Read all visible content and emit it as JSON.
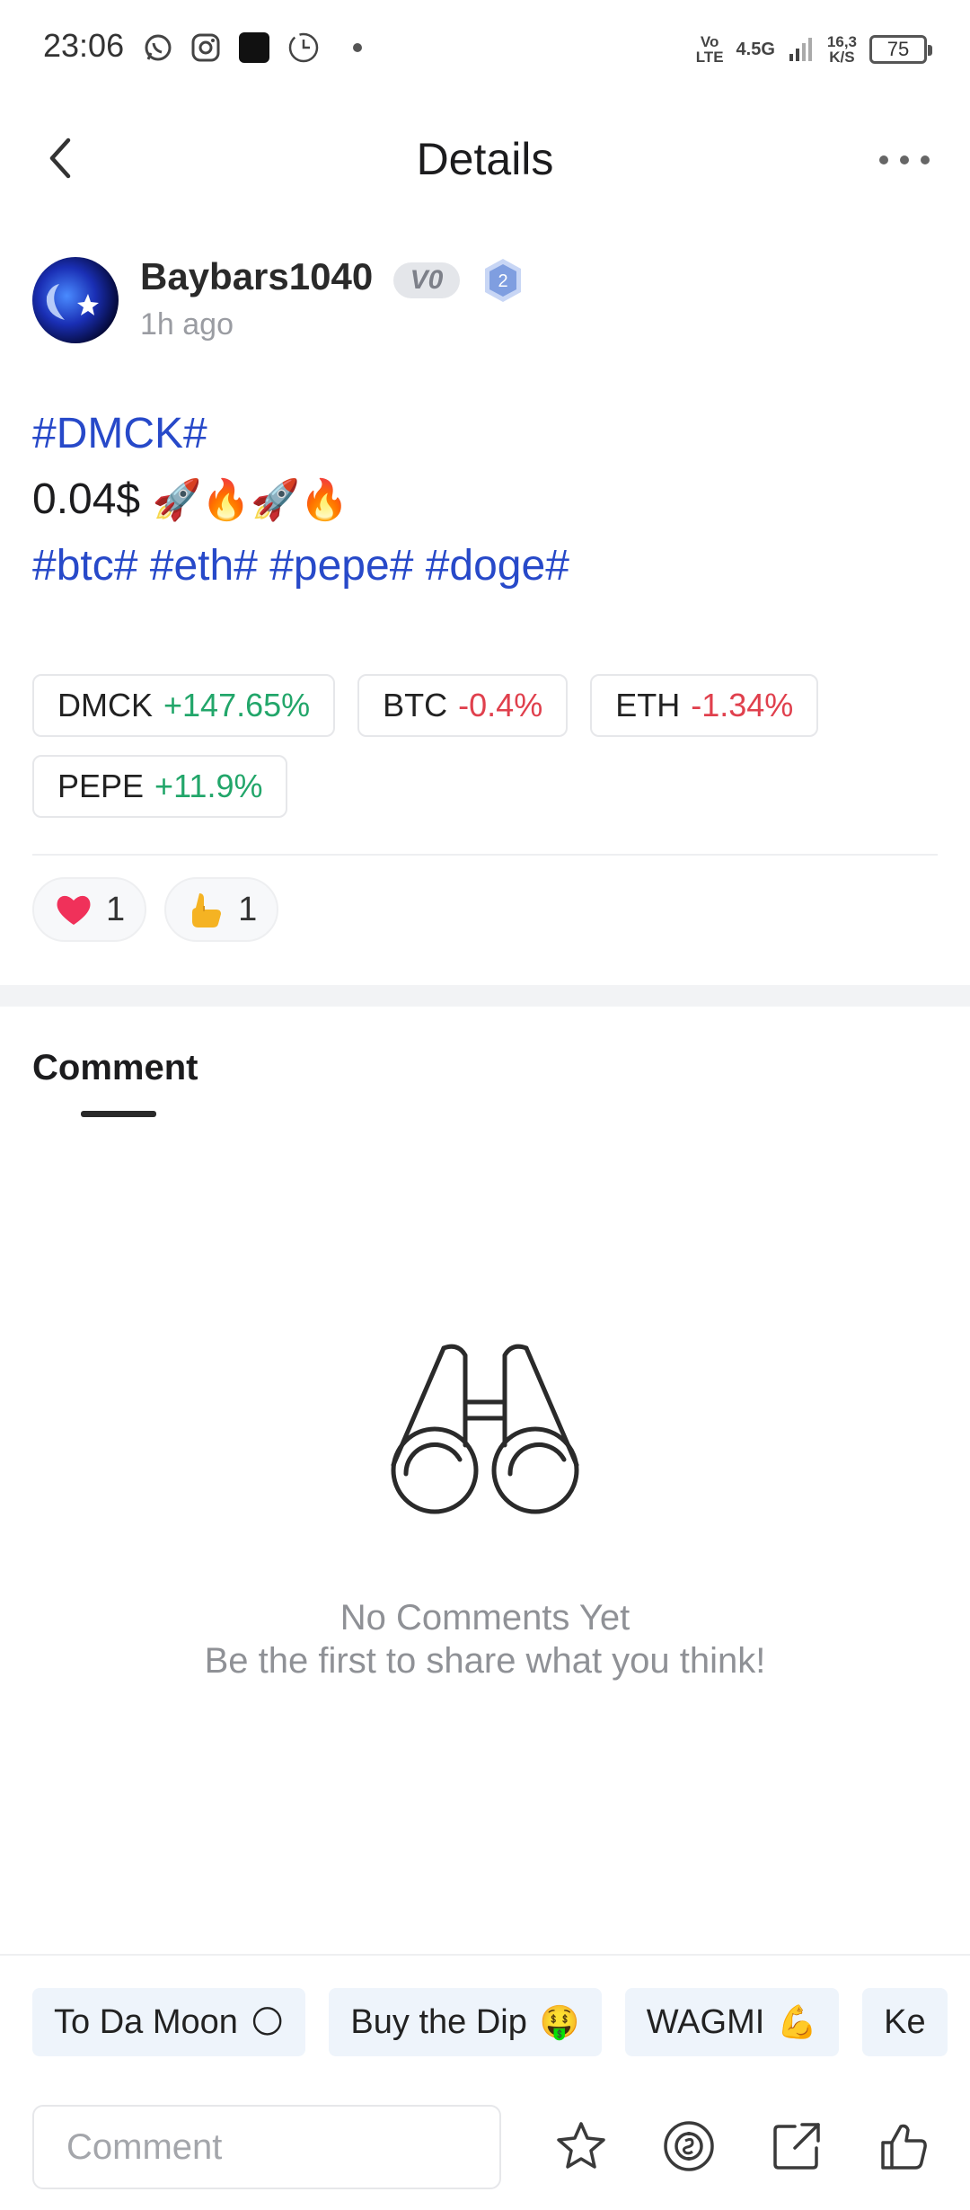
{
  "status_bar": {
    "time": "23:06",
    "network_top": "Vo",
    "network_bottom": "LTE",
    "signal": "4.5G",
    "speed_top": "16,3",
    "speed_bottom": "K/S",
    "battery": "75",
    "icons": [
      "whatsapp-icon",
      "instagram-icon",
      "app-icon",
      "clock-icon",
      "dot-icon"
    ]
  },
  "header": {
    "title": "Details",
    "back_icon": "chevron-left-icon",
    "more_icon": "more-dots-icon"
  },
  "author": {
    "name": "Baybars1040",
    "vip": "V0",
    "level": "2",
    "time_ago": "1h ago"
  },
  "post": {
    "line1_tag": "#DMCK#",
    "line2_text": "0.04$",
    "line2_emojis": "🚀🔥🚀🔥",
    "line3_tags": "#btc# #eth# #pepe# #doge#"
  },
  "coins": [
    {
      "symbol": "DMCK",
      "change": "+147.65%",
      "direction": "up"
    },
    {
      "symbol": "BTC",
      "change": "-0.4%",
      "direction": "down"
    },
    {
      "symbol": "ETH",
      "change": "-1.34%",
      "direction": "down"
    },
    {
      "symbol": "PEPE",
      "change": "+11.9%",
      "direction": "up"
    }
  ],
  "colors": {
    "tag": "#2749c9",
    "up": "#22a66a",
    "down": "#e0404d"
  },
  "reactions": [
    {
      "icon": "heart-icon",
      "count": "1"
    },
    {
      "icon": "thumbs-up-icon",
      "count": "1"
    }
  ],
  "comments": {
    "tab_label": "Comment",
    "empty_title": "No Comments Yet",
    "empty_subtitle": "Be the first to share what you think!",
    "empty_icon": "binoculars-icon"
  },
  "quick_replies": [
    {
      "label": "To Da Moon",
      "emoji": "🌕"
    },
    {
      "label": "Buy the Dip",
      "emoji": "🤑"
    },
    {
      "label": "WAGMI",
      "emoji": "💪"
    },
    {
      "label": "Ke",
      "emoji": ""
    }
  ],
  "bottom_bar": {
    "input_placeholder": "Comment",
    "actions": [
      "star-icon",
      "tip-icon",
      "share-icon",
      "like-icon"
    ]
  }
}
